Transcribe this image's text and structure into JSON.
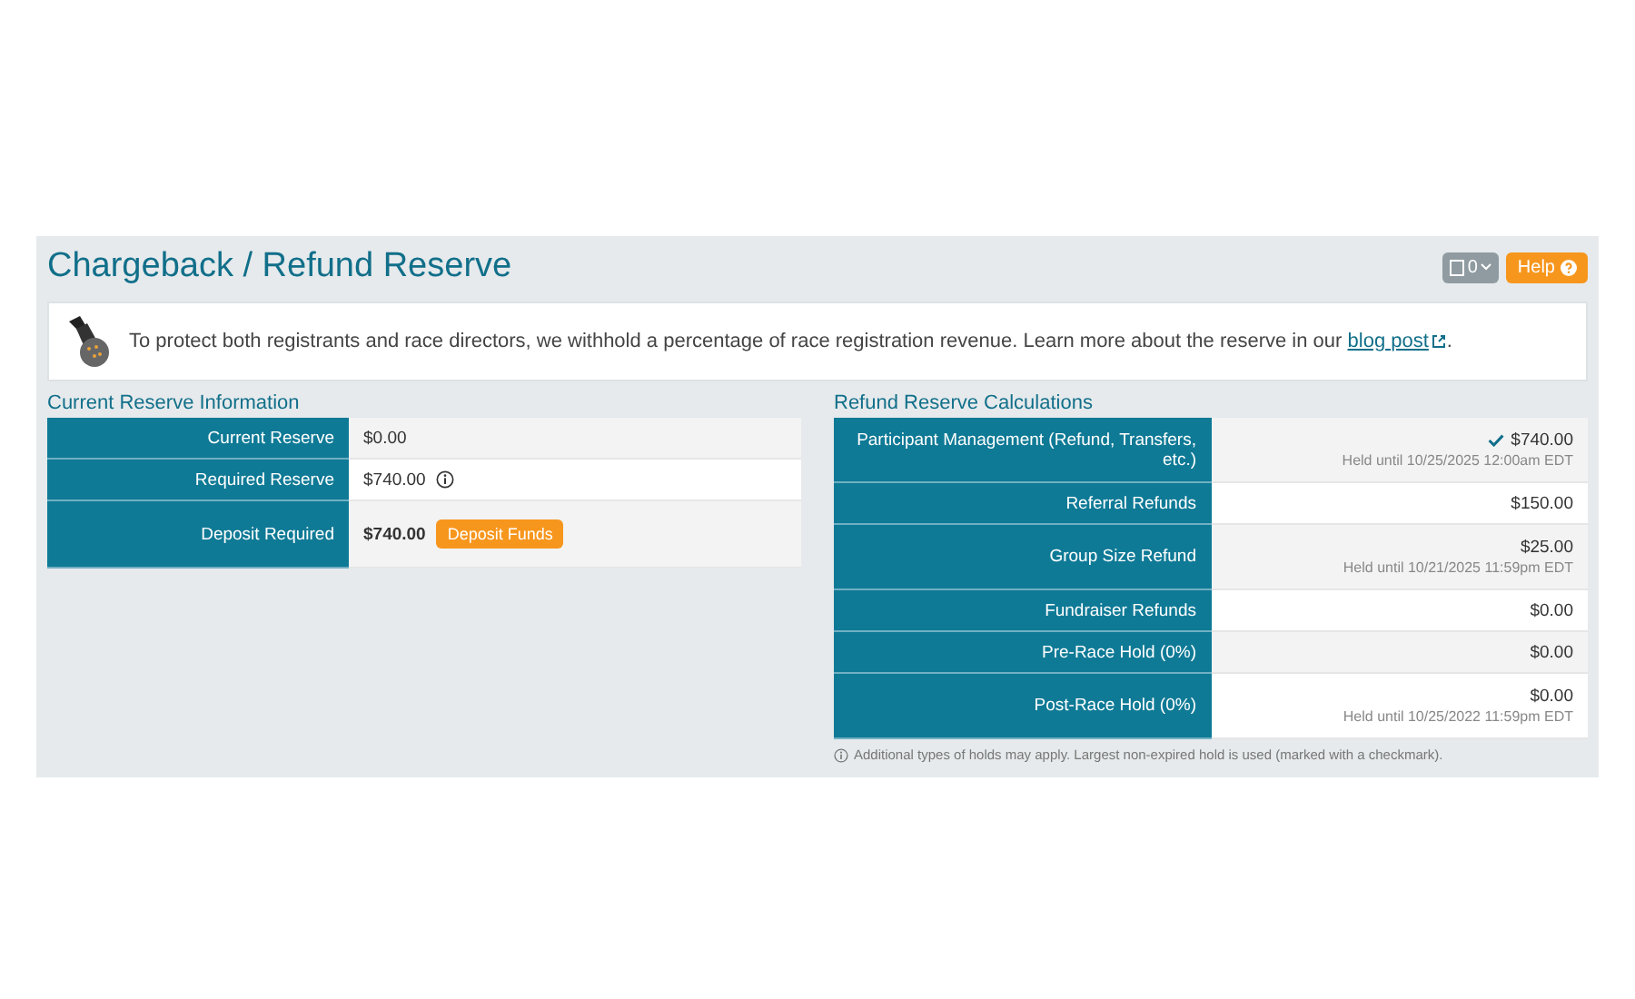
{
  "title": "Chargeback / Refund Reserve",
  "toolbar": {
    "counter": "0",
    "help": "Help"
  },
  "notice": {
    "text": "To protect both registrants and race directors, we withhold a percentage of race registration revenue. Learn more about the reserve in our ",
    "link": "blog post",
    "end": "."
  },
  "current_reserve": {
    "heading": "Current Reserve Information",
    "rows": [
      {
        "label": "Current Reserve",
        "value": "$0.00",
        "kind": "plain"
      },
      {
        "label": "Required Reserve",
        "value": "$740.00",
        "kind": "info"
      },
      {
        "label": "Deposit Required",
        "value": "$740.00",
        "kind": "action",
        "button": "Deposit Funds"
      }
    ]
  },
  "calculations": {
    "heading": "Refund Reserve Calculations",
    "rows": [
      {
        "label": "Participant Management (Refund, Transfers, etc.)",
        "value": "$740.00",
        "held": "Held until 10/25/2025 12:00am EDT",
        "checked": true
      },
      {
        "label": "Referral Refunds",
        "value": "$150.00",
        "checked": false
      },
      {
        "label": "Group Size Refund",
        "value": "$25.00",
        "held": "Held until 10/21/2025 11:59pm EDT",
        "checked": false
      },
      {
        "label": "Fundraiser Refunds",
        "value": "$0.00",
        "checked": false
      },
      {
        "label": "Pre-Race Hold (0%)",
        "value": "$0.00",
        "checked": false
      },
      {
        "label": "Post-Race Hold (0%)",
        "value": "$0.00",
        "held": "Held until 10/25/2022 11:59pm EDT",
        "checked": false
      }
    ],
    "footnote": "Additional types of holds may apply. Largest non-expired hold is used (marked with a checkmark)."
  }
}
